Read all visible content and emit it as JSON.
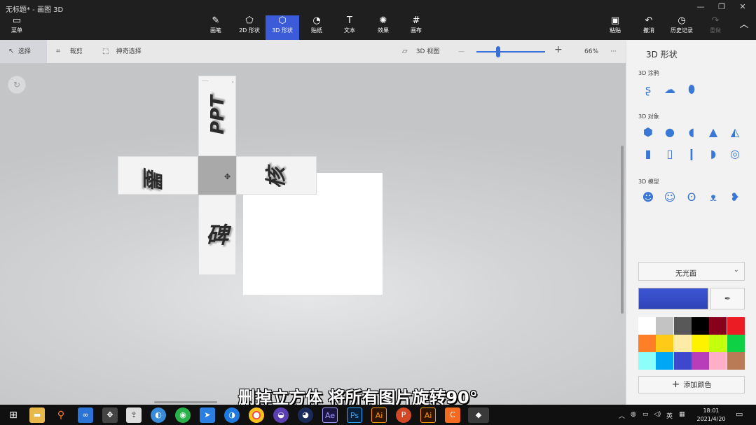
{
  "window": {
    "title": "无标题* - 画图 3D",
    "minimize": "—",
    "restore": "❐",
    "close": "✕"
  },
  "menu": {
    "icon": "menu-icon",
    "label": "菜单"
  },
  "tools": [
    {
      "label": "画笔",
      "icon": "brush-icon"
    },
    {
      "label": "2D 形状",
      "icon": "2d-shapes-icon"
    },
    {
      "label": "3D 形状",
      "icon": "3d-shapes-icon",
      "active": true
    },
    {
      "label": "贴纸",
      "icon": "stickers-icon"
    },
    {
      "label": "文本",
      "icon": "text-icon"
    },
    {
      "label": "效果",
      "icon": "effects-icon"
    },
    {
      "label": "画布",
      "icon": "canvas-icon"
    }
  ],
  "actions": {
    "paste": "粘贴",
    "undo": "撤消",
    "history": "历史记录",
    "redo": "重做"
  },
  "toolbar2": {
    "select": "选择",
    "crop": "裁剪",
    "magic_select": "神奇选择",
    "view3d": "3D 视图",
    "zoom_minus": "—",
    "zoom_plus": "+",
    "zoom_pct": "66%",
    "more": "···",
    "zoom_level": 0.3
  },
  "canvas_faces": {
    "top": "PPT",
    "left": "墨",
    "right": "核",
    "bottom": "碑"
  },
  "panel": {
    "title": "3D 形状",
    "doodles_label": "3D 涂鸦",
    "doodles": [
      "sharp-edge-doodle-icon",
      "soft-edge-doodle-icon",
      "tube-doodle-icon"
    ],
    "objects_label": "3D 对象",
    "objects_row1": [
      "cube-icon",
      "sphere-icon",
      "hemisphere-icon",
      "cone-icon",
      "pyramid-icon"
    ],
    "objects_row2": [
      "cylinder-icon",
      "tube-icon",
      "capsule-icon",
      "curved-tube-icon",
      "donut-icon"
    ],
    "models_label": "3D 模型",
    "models": [
      "man-model-icon",
      "woman-model-icon",
      "dog-model-icon",
      "cat-model-icon",
      "fish-model-icon"
    ],
    "material": "无光面",
    "add_color": "添加颜色",
    "colors": [
      "#ffffff",
      "#c3c3c3",
      "#585858",
      "#000000",
      "#88001b",
      "#ec1c24",
      "#ff7f27",
      "#ffca18",
      "#fdeca6",
      "#fff200",
      "#c4ff0e",
      "#0ed145",
      "#8cfffb",
      "#00a8f3",
      "#3f48cc",
      "#b83dba",
      "#ffaec8",
      "#b97a56"
    ]
  },
  "subtitle": "删掉立方体 将所有图片旋转90°",
  "taskbar": {
    "apps": [
      "start-icon",
      "explorer-icon",
      "search-icon",
      "baidu-icon",
      "app-icon",
      "wechat-icon",
      "feishu-icon",
      "browser-icon",
      "chrome-icon",
      "obs-icon",
      "cinema4d-icon",
      "ae-icon",
      "ps-icon",
      "ai-icon",
      "ppt-icon",
      "ai-icon-2",
      "c-icon",
      "paint3d-icon"
    ],
    "ae": "Ae",
    "ps": "Ps",
    "ai": "Ai",
    "ai2": "Ai",
    "c": "C",
    "lang": "英",
    "time": "18:01",
    "date": "2021/4/20"
  }
}
